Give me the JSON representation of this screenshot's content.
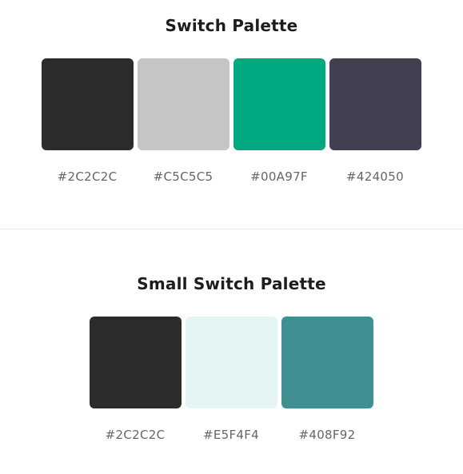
{
  "palette_1": {
    "title": "Switch Palette",
    "colors": [
      {
        "hex": "#2C2C2C",
        "label": "#2C2C2C"
      },
      {
        "hex": "#C5C5C5",
        "label": "#C5C5C5"
      },
      {
        "hex": "#00A97F",
        "label": "#00A97F"
      },
      {
        "hex": "#424050",
        "label": "#424050"
      }
    ]
  },
  "palette_2": {
    "title": "Small Switch Palette",
    "colors": [
      {
        "hex": "#2C2C2C",
        "label": "#2C2C2C"
      },
      {
        "hex": "#E5F4F4",
        "label": "#E5F4F4"
      },
      {
        "hex": "#408F92",
        "label": "#408F92"
      }
    ]
  }
}
